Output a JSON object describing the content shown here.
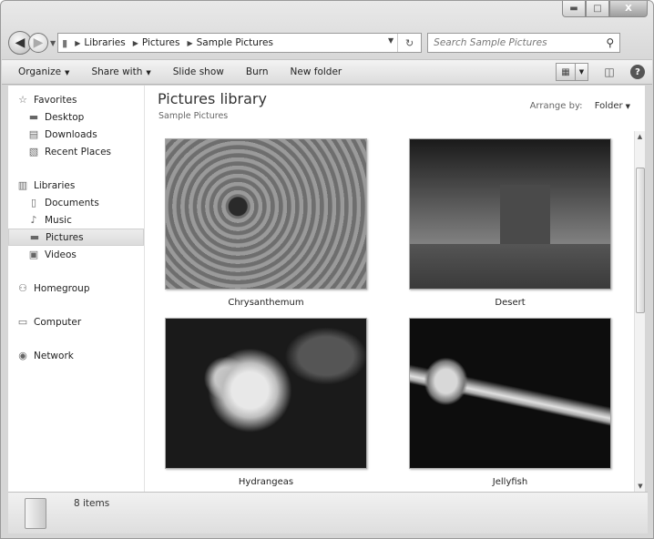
{
  "window": {
    "caption": {
      "minimize": "▬",
      "maximize": "□",
      "close": "X"
    }
  },
  "address": {
    "crumbs": [
      "Libraries",
      "Pictures",
      "Sample Pictures"
    ],
    "refresh_glyph": "↻"
  },
  "search": {
    "placeholder": "Search Sample Pictures"
  },
  "toolbar": {
    "organize": "Organize",
    "share_with": "Share with",
    "slide_show": "Slide show",
    "burn": "Burn",
    "new_folder": "New folder"
  },
  "nav": {
    "favorites": {
      "label": "Favorites",
      "items": [
        "Desktop",
        "Downloads",
        "Recent Places"
      ]
    },
    "libraries": {
      "label": "Libraries",
      "items": [
        "Documents",
        "Music",
        "Pictures",
        "Videos"
      ],
      "selected": "Pictures"
    },
    "homegroup": "Homegroup",
    "computer": "Computer",
    "network": "Network"
  },
  "content": {
    "title": "Pictures library",
    "subtitle": "Sample Pictures",
    "arrange_label": "Arrange by:",
    "arrange_value": "Folder",
    "items": [
      {
        "name": "Chrysanthemum"
      },
      {
        "name": "Desert"
      },
      {
        "name": "Hydrangeas"
      },
      {
        "name": "Jellyfish"
      }
    ]
  },
  "details": {
    "item_count": "8 items"
  }
}
